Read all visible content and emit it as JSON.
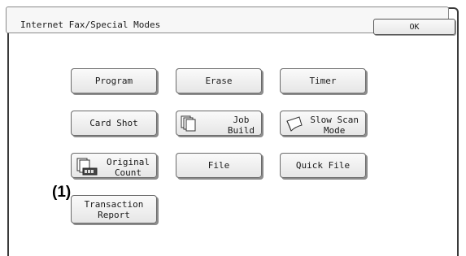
{
  "title": "Internet Fax/Special Modes",
  "ok_label": "OK",
  "buttons": {
    "program": "Program",
    "erase": "Erase",
    "timer": "Timer",
    "card_shot": "Card Shot",
    "job_build": "Job\nBuild",
    "slow_scan": "Slow Scan\nMode",
    "original_count": "Original\nCount",
    "file": "File",
    "quick_file": "Quick File",
    "transaction_report": "Transaction\nReport"
  },
  "icons": {
    "job_build": "stacked-pages-icon",
    "slow_scan": "curled-page-icon",
    "original_count": "page-counter-icon"
  },
  "callout": "(1)"
}
